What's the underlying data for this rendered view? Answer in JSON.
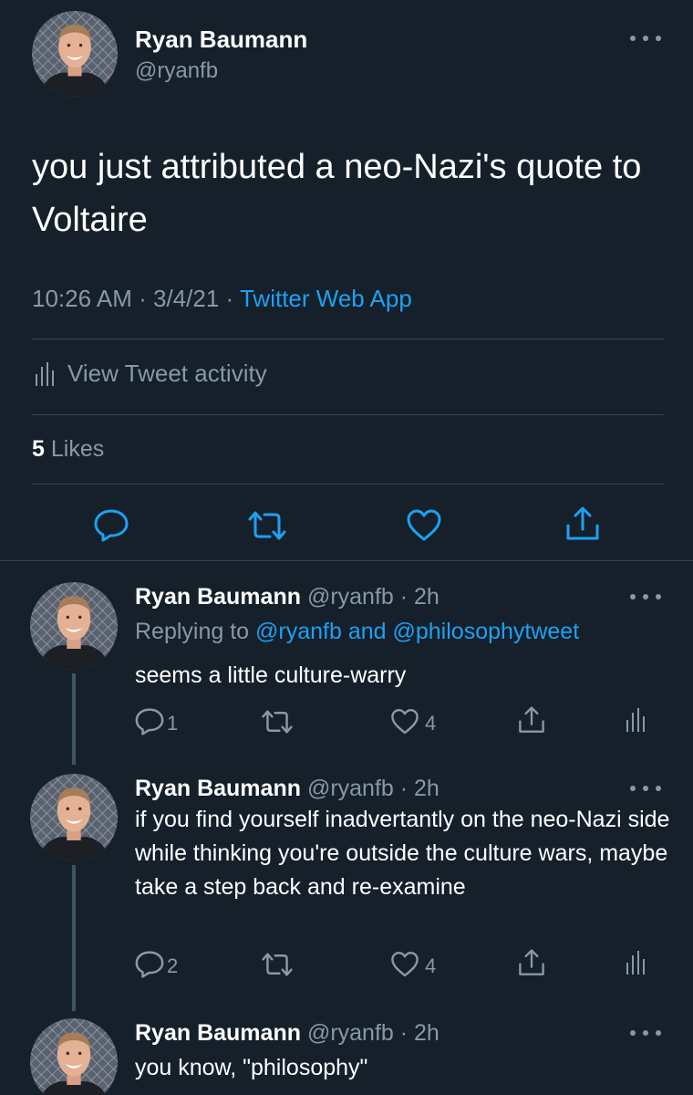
{
  "main_tweet": {
    "name": "Ryan Baumann",
    "handle": "@ryanfb",
    "text": "you just attributed a neo-Nazi's quote to Voltaire",
    "time": "10:26 AM",
    "date": "3/4/21",
    "dot": "·",
    "source": "Twitter Web App",
    "activity_label": "View Tweet activity",
    "likes_count": "5",
    "likes_label": "Likes",
    "icons": [
      "reply-icon",
      "retweet-icon",
      "like-icon",
      "share-icon"
    ]
  },
  "replies": [
    {
      "name": "Ryan Baumann",
      "handle_time": "@ryanfb · 2h",
      "replying_prefix": "Replying to",
      "replying_to": "@ryanfb and @philosophytweet",
      "text": "seems a little culture-warry",
      "reply_count": "1",
      "like_count": "4"
    },
    {
      "name": "Ryan Baumann",
      "handle_time": "@ryanfb · 2h",
      "text": "if you find yourself inadvertantly on the neo-Nazi side while thinking you're outside the culture wars, maybe take a step back and re-examine",
      "reply_count": "2",
      "like_count": "4"
    },
    {
      "name": "Ryan Baumann",
      "handle_time": "@ryanfb · 2h",
      "text": "you know, \"philosophy\""
    }
  ],
  "colors": {
    "background": "#15202b",
    "text": "#ffffff",
    "secondary": "#8899a6",
    "accent": "#1da1f2",
    "divider": "#38444d"
  }
}
